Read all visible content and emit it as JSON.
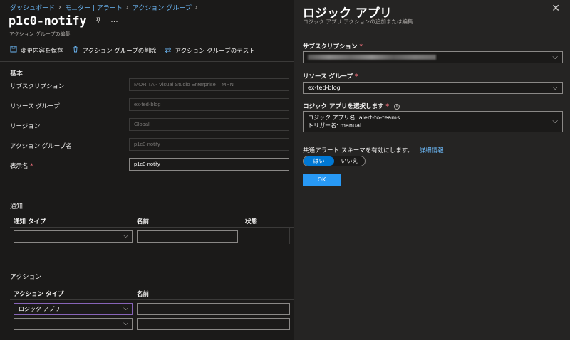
{
  "breadcrumb": [
    "ダッシュボード",
    "モニター | アラート",
    "アクション グループ"
  ],
  "page": {
    "title": "p1c0-notify",
    "subtitle": "アクション グループの編集"
  },
  "toolbar": {
    "save": "変更内容を保存",
    "delete": "アクション グループの削除",
    "test": "アクション グループのテスト"
  },
  "basic": {
    "heading": "基本",
    "fields": [
      {
        "label": "サブスクリプション",
        "value": "MORITA - Visual Studio Enterprise – MPN",
        "required": false
      },
      {
        "label": "リソース グループ",
        "value": "ex-ted-blog",
        "required": false
      },
      {
        "label": "リージョン",
        "value": "Global",
        "required": false
      },
      {
        "label": "アクション グループ名",
        "value": "p1c0-notify",
        "required": false
      },
      {
        "label": "表示名",
        "value": "p1c0-notify",
        "required": true
      }
    ]
  },
  "notification": {
    "heading": "通知",
    "columns": [
      "通知 タイプ",
      "名前",
      "状態"
    ]
  },
  "actions": {
    "heading": "アクション",
    "columns": [
      "アクション タイプ",
      "名前"
    ],
    "rows": [
      {
        "type": "ロジック アプリ",
        "name": ""
      },
      {
        "type": "",
        "name": ""
      }
    ]
  },
  "panel": {
    "title": "ロジック アプリ",
    "subtitle": "ロジック アプリ アクションの追加または編集",
    "subscription_label": "サブスクリプション",
    "resource_group_label": "リソース グループ",
    "resource_group_value": "ex-ted-blog",
    "logic_app_label": "ロジック アプリを選択します",
    "logic_app_line1": "ロジック アプリ名: alert-to-teams",
    "logic_app_line2": "トリガー名: manual",
    "schema_label": "共通アラート スキーマを有効にします。",
    "schema_link": "詳細情報",
    "toggle_yes": "はい",
    "toggle_no": "いいえ",
    "ok": "OK"
  },
  "icons": [
    "chevron-right-icon",
    "pin-icon",
    "more-icon",
    "save-icon",
    "trash-icon",
    "swap-icon",
    "close-icon",
    "chevron-down-icon",
    "info-icon"
  ],
  "colors": {
    "accent": "#0078d4",
    "link": "#6cb8f6",
    "required": "#f1707b"
  }
}
